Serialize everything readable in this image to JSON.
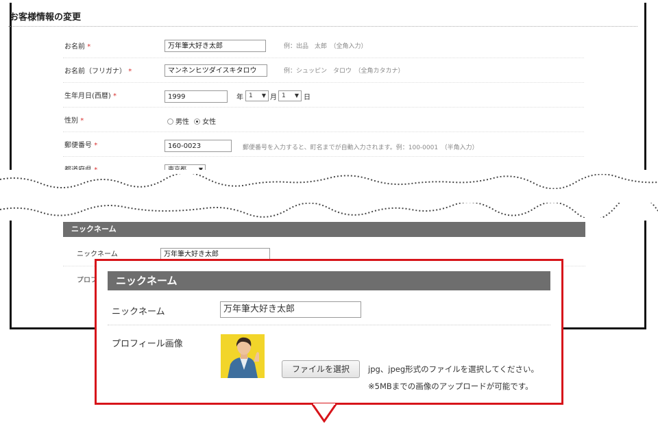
{
  "page": {
    "title": "お客様情報の変更"
  },
  "required_mark": "*",
  "form": {
    "name": {
      "label": "お名前",
      "value": "万年筆大好き太郎",
      "hint": "例：出品　太郎　（全角入力）"
    },
    "kana": {
      "label": "お名前（フリガナ）",
      "value": "マンネンヒツダイスキタロウ",
      "hint": "例：シュッピン　タロウ　（全角カタカナ）"
    },
    "birth": {
      "label": "生年月日(西暦)",
      "year": "1999",
      "year_unit": "年",
      "month": "1",
      "month_unit": "月",
      "day": "1",
      "day_unit": "日"
    },
    "gender": {
      "label": "性別",
      "options": [
        "男性",
        "女性"
      ],
      "selected": "女性"
    },
    "zip": {
      "label": "郵便番号",
      "value": "160-0023",
      "hint": "郵便番号を入力すると、町名までが自動入力されます。例：100-0001　（半角入力）"
    },
    "pref": {
      "label": "都道府県",
      "value": "東京都"
    }
  },
  "nickname_small": {
    "header": "ニックネーム",
    "nick_label": "ニックネーム",
    "nick_value": "万年筆大好き太郎",
    "profile_label_partial": "プロフ"
  },
  "callout": {
    "header": "ニックネーム",
    "nick_label": "ニックネーム",
    "nick_value": "万年筆大好き太郎",
    "profile_label": "プロフィール画像",
    "file_button": "ファイルを選択",
    "note1": "jpg、jpeg形式のファイルを選択してください。",
    "note2": "※5MBまでの画像のアップロードが可能です。"
  },
  "colors": {
    "accent_red": "#d7141a",
    "header_gray": "#6e6e6e",
    "required_red": "#d8312f",
    "avatar_bg": "#f2d52a"
  },
  "icons": [
    "chevron-down-icon",
    "radio-icon",
    "avatar-icon",
    "wave-divider-icon",
    "callout-pointer-icon"
  ]
}
